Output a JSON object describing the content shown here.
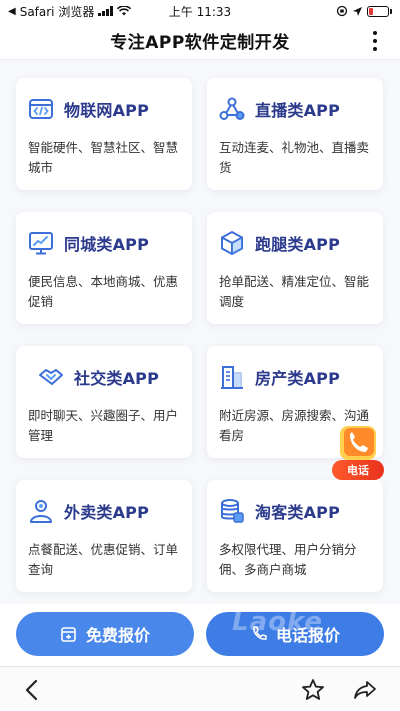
{
  "status_bar": {
    "carrier": "Safari 浏览器",
    "time": "上午 11:33"
  },
  "header": {
    "title": "专注APP软件定制开发"
  },
  "cards": [
    {
      "title": "物联网APP",
      "desc": "智能硬件、智慧社区、智慧城市",
      "icon": "code-window-icon"
    },
    {
      "title": "直播类APP",
      "desc": "互动连麦、礼物池、直播卖货",
      "icon": "network-nodes-icon"
    },
    {
      "title": "同城类APP",
      "desc": "便民信息、本地商城、优惠促销",
      "icon": "monitor-chart-icon"
    },
    {
      "title": "跑腿类APP",
      "desc": "抢单配送、精准定位、智能调度",
      "icon": "cube-icon"
    },
    {
      "title": "社交类APP",
      "desc": "即时聊天、兴趣圈子、用户管理",
      "icon": "handshake-icon"
    },
    {
      "title": "房产类APP",
      "desc": "附近房源、房源搜索、沟通看房",
      "icon": "buildings-icon"
    },
    {
      "title": "外卖类APP",
      "desc": "点餐配送、优惠促销、订单查询",
      "icon": "user-icon"
    },
    {
      "title": "淘客类APP",
      "desc": "多权限代理、用户分销分佣、多商户商城",
      "icon": "database-icon"
    }
  ],
  "float_call": {
    "label": "电话"
  },
  "actions": {
    "quote_label": "免费报价",
    "call_label": "电话报价"
  },
  "watermark": "Laoke",
  "colors": {
    "accent": "#4a87ea",
    "title_text": "#2b3a8c",
    "icon_blue": "#3d6fd8",
    "call_tag": "#e8321c"
  }
}
